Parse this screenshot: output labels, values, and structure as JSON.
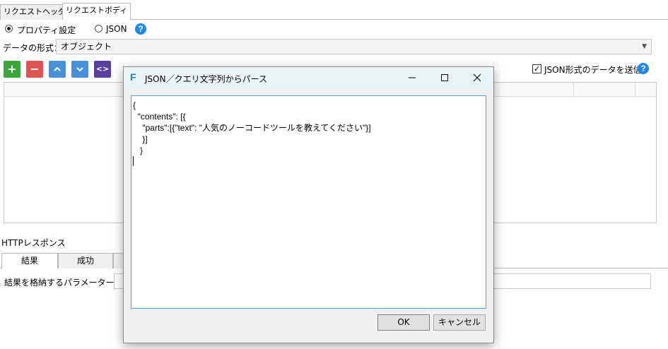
{
  "tabs": {
    "header_tab": "リクエストヘッダー",
    "body_tab": "リクエストボディ"
  },
  "mode": {
    "property_label": "プロパティ設定",
    "json_label": "JSON",
    "selected": "property"
  },
  "data_format": {
    "label": "データの形式：",
    "value": "オブジェクト"
  },
  "toolbar": {
    "add_label": "+",
    "remove_label": "−",
    "up_label": "⌃",
    "down_label": "⌄",
    "code_label": "<>"
  },
  "json_send": {
    "label": "JSON形式のデータを送信",
    "checked": true
  },
  "http_response": {
    "title": "HTTPレスポンス",
    "tabs": [
      "結果",
      "成功"
    ],
    "param_label": "結果を格納するパラメーター名："
  },
  "dialog": {
    "title": "JSON／クエリ文字列からパース",
    "content": "{\n  \"contents\": [{\n    \"parts\":[{\"text\": \"人気のノーコードツールを教えてください\"}]\n    }]\n   }\n",
    "ok_label": "OK",
    "cancel_label": "キャンセル"
  },
  "icons": {
    "help": "help-icon",
    "dialog_app": "f-app-icon",
    "minimize": "minimize-icon",
    "maximize": "maximize-icon",
    "close": "close-icon"
  },
  "colors": {
    "add": "#3ba63b",
    "remove": "#e05454",
    "move": "#4a90d9",
    "code": "#5b3f9e",
    "help": "#1f87e5"
  }
}
